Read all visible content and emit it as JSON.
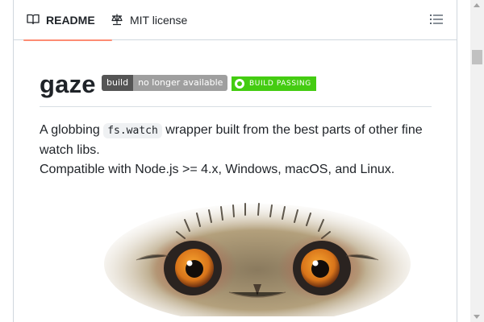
{
  "tabs": {
    "readme_label": "README",
    "license_label": "MIT license"
  },
  "readme": {
    "title": "gaze",
    "badge_build_left": "build",
    "badge_build_right": "no longer available",
    "badge_passing": "BUILD PASSING",
    "desc_before": "A globbing ",
    "desc_code": "fs.watch",
    "desc_after": " wrapper built from the best parts of other fine watch libs.",
    "compat": "Compatible with Node.js >= 4.x, Windows, macOS, and Linux."
  },
  "icons": {
    "readme_tab": "book-icon",
    "license_tab": "scale-icon",
    "outline": "list-icon"
  },
  "colors": {
    "active_tab_underline": "#fd8c73",
    "badge_pass": "#44cc11",
    "badge_dark": "#555555",
    "badge_gray": "#9f9f9f"
  }
}
